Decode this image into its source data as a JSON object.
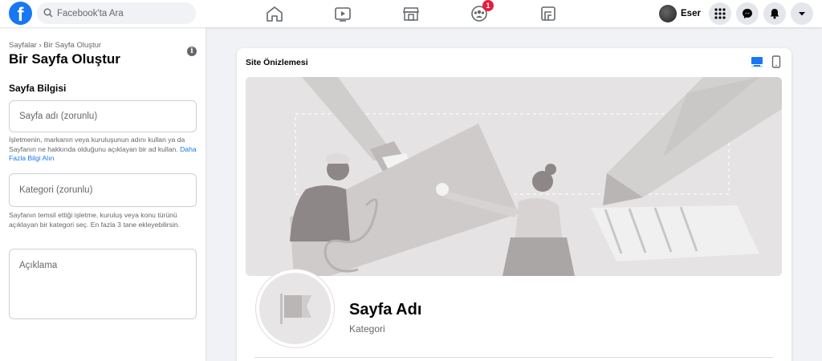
{
  "topnav": {
    "logo": "f",
    "search_placeholder": "Facebook'ta Ara",
    "icons": [
      "home-icon",
      "watch-icon",
      "marketplace-icon",
      "groups-icon",
      "gaming-icon"
    ],
    "groups_badge": "1",
    "profile_name": "Eser",
    "right_buttons": [
      "menu-grid-icon",
      "messenger-icon",
      "notifications-icon",
      "account-dropdown-icon"
    ],
    "accent": "#1877f2",
    "badge_color": "#e41e3f"
  },
  "left": {
    "breadcrumb": "Sayfalar › Bir Sayfa Oluştur",
    "title": "Bir Sayfa Oluştur",
    "info": "i",
    "section_title": "Sayfa Bilgisi",
    "page_name_placeholder": "Sayfa adı (zorunlu)",
    "page_name_help": "İşletmenin, markanın veya kuruluşunun adını kullan ya da Sayfanın ne hakkında olduğunu açıklayan bir ad kullan.",
    "page_name_help_link": "Daha Fazla Bilgi Alın",
    "category_placeholder": "Kategori (zorunlu)",
    "category_help": "Sayfanın temsil ettiği işletme, kuruluş veya konu türünü açıklayan bir kategori seç. En fazla 3 tane ekleyebilirsin.",
    "description_placeholder": "Açıklama"
  },
  "preview": {
    "title": "Site Önizlemesi",
    "page_name": "Sayfa Adı",
    "category": "Kategori",
    "active_view": "desktop"
  }
}
